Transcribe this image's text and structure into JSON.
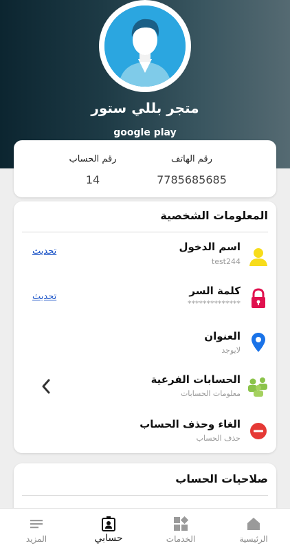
{
  "profile": {
    "store_name": "متجر بللي ستور",
    "store_subtitle": "google play"
  },
  "stats": {
    "phone_label": "رقم الهاتف",
    "phone_value": "7785685685",
    "account_label": "رقم الحساب",
    "account_value": "14"
  },
  "personal": {
    "title": "المعلومات الشخصية",
    "rows": [
      {
        "title": "اسم الدخول",
        "sub": "test244",
        "link": "تحديث",
        "icon": "user-icon"
      },
      {
        "title": "كلمة السر",
        "sub": "**************",
        "link": "تحديث",
        "icon": "lock-icon"
      },
      {
        "title": "العنوان",
        "sub": "لايوجد",
        "icon": "location-pin-icon"
      },
      {
        "title": "الحسابات الفرعية",
        "sub": "معلومات الحسابات",
        "icon": "group-icon"
      },
      {
        "title": "الغاء وحذف الحساب",
        "sub": "حذف الحساب",
        "icon": "remove-icon"
      }
    ]
  },
  "permissions": {
    "title": "صلاحيات الحساب"
  },
  "nav": {
    "items": [
      {
        "label": "الرئيسية",
        "icon": "home-icon"
      },
      {
        "label": "الخدمات",
        "icon": "services-grid-icon"
      },
      {
        "label": "حسابي",
        "icon": "account-badge-icon",
        "active": true
      },
      {
        "label": "المزيد",
        "icon": "menu-lines-icon"
      }
    ]
  },
  "colors": {
    "link": "#1e56c8",
    "user_icon": "#f7dc1b",
    "lock_icon": "#e0114e",
    "pin_icon": "#1a73e8",
    "group_icon": "#8bc34a",
    "remove_icon": "#e53935"
  }
}
